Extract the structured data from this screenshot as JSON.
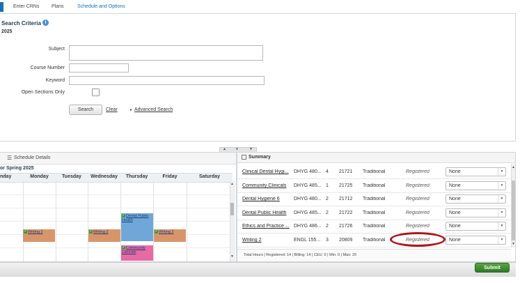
{
  "tabs": [
    {
      "label": "Enter CRNs"
    },
    {
      "label": "Plans"
    },
    {
      "label": "Schedule and Options"
    }
  ],
  "search": {
    "title": "Search Criteria",
    "term": "2025",
    "subject_label": "Subject",
    "course_number_label": "Course Number",
    "keyword_label": "Keyword",
    "open_sections_label": "Open Sections Only",
    "search_button": "Search",
    "clear_link": "Clear",
    "advanced_link": "Advanced Search"
  },
  "schedule": {
    "title": "Schedule Details",
    "term_label": "or Spring 2025",
    "days": [
      "nday",
      "Monday",
      "Tuesday",
      "Wednesday",
      "Thursday",
      "Friday",
      "Saturday"
    ],
    "events": [
      {
        "label": "Dental Public Health",
        "day": "Thursday"
      },
      {
        "label": "Writing 2",
        "day": "Monday"
      },
      {
        "label": "Writing 2",
        "day": "Wednesday"
      },
      {
        "label": "Writing 2",
        "day": "Friday"
      },
      {
        "label": "Community Clinicals",
        "day": "Thursday"
      }
    ],
    "colors": {
      "dental": "#6fa8d8",
      "writing": "#d9956a",
      "community": "#e86aa2"
    }
  },
  "summary": {
    "title": "Summary",
    "rows": [
      {
        "title": "Clinical Dental Hygi...",
        "course": "DHYG 480...",
        "hours": "4",
        "crn": "21721",
        "schedule_type": "Traditional",
        "status": "Registered",
        "action": "None"
      },
      {
        "title": "Community Clinicals",
        "course": "DHYG 485...",
        "hours": "1",
        "crn": "21725",
        "schedule_type": "Traditional",
        "status": "Registered",
        "action": "None"
      },
      {
        "title": "Dental Hygiene 6",
        "course": "DHYG 480...",
        "hours": "2",
        "crn": "21712",
        "schedule_type": "Traditional",
        "status": "Registered",
        "action": "None"
      },
      {
        "title": "Dental Public Health",
        "course": "DHYG 485...",
        "hours": "2",
        "crn": "21722",
        "schedule_type": "Traditional",
        "status": "Registered",
        "action": "None"
      },
      {
        "title": "Ethics and Practice ...",
        "course": "DHYG 486...",
        "hours": "2",
        "crn": "21726",
        "schedule_type": "Traditional",
        "status": "Registered",
        "action": "None"
      },
      {
        "title": "Writing 2",
        "course": "ENGL 155...",
        "hours": "3",
        "crn": "20809",
        "schedule_type": "Traditional",
        "status": "Registered",
        "action": "None"
      }
    ],
    "totals": "Total Hours | Registered: 14 | Billing: 14 | CEU: 0 | Min: 0 | Max: 20"
  },
  "footer": {
    "submit_label": "Submit"
  }
}
